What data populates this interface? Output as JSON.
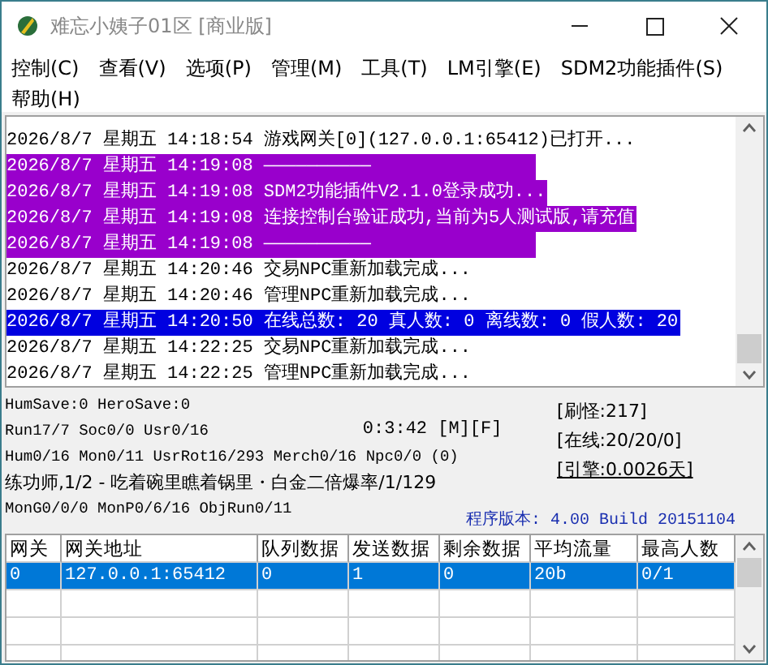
{
  "window": {
    "title": "难忘小姨子01区 [商业版]"
  },
  "menu": [
    {
      "label": "控制(C)"
    },
    {
      "label": "查看(V)"
    },
    {
      "label": "选项(P)"
    },
    {
      "label": "管理(M)"
    },
    {
      "label": "工具(T)"
    },
    {
      "label": "LM引擎(E)"
    },
    {
      "label": "SDM2功能插件(S)"
    },
    {
      "label": "帮助(H)"
    }
  ],
  "log": [
    {
      "date": "2026/8/7",
      "weekday": "星期五",
      "time": "14:18:54",
      "message": "游戏网关[0](127.0.0.1:65412)已打开..."
    },
    {
      "date": "2026/8/7",
      "weekday": "星期五",
      "time": "14:19:08",
      "message": "――――――――――",
      "color": "#9900cc"
    },
    {
      "date": "2026/8/7",
      "weekday": "星期五",
      "time": "14:19:08",
      "message": "SDM2功能插件V2.1.0登录成功...",
      "color": "#9900cc"
    },
    {
      "date": "2026/8/7",
      "weekday": "星期五",
      "time": "14:19:08",
      "message": "连接控制台验证成功,当前为5人测试版,请充值",
      "color": "#9900cc"
    },
    {
      "date": "2026/8/7",
      "weekday": "星期五",
      "time": "14:19:08",
      "message": "――――――――――",
      "color": "#9900cc"
    },
    {
      "date": "2026/8/7",
      "weekday": "星期五",
      "time": "14:20:46",
      "message": "交易NPC重新加载完成..."
    },
    {
      "date": "2026/8/7",
      "weekday": "星期五",
      "time": "14:20:46",
      "message": "管理NPC重新加载完成..."
    },
    {
      "date": "2026/8/7",
      "weekday": "星期五",
      "time": "14:20:50",
      "message": "在线总数: 20 真人数: 0 离线数: 0 假人数: 20",
      "color": "#0000e0"
    },
    {
      "date": "2026/8/7",
      "weekday": "星期五",
      "time": "14:22:25",
      "message": "交易NPC重新加载完成..."
    },
    {
      "date": "2026/8/7",
      "weekday": "星期五",
      "time": "14:22:25",
      "message": "管理NPC重新加载完成..."
    }
  ],
  "status": {
    "lines": [
      {
        "text": "HumSave:0 HeroSave:0",
        "kind": "mono"
      },
      {
        "text": "Run17/7 Soc0/0 Usr0/16",
        "kind": "mono",
        "timer": "0:3:42 [M][F]"
      },
      {
        "text": "Hum0/16 Mon0/11 UsrRot16/293 Merch0/16 Npc0/0 (0)",
        "kind": "mono"
      },
      {
        "text": "练功师,1/2 - 吃着碗里瞧着锅里・白金二倍爆率/1/129",
        "kind": "sans"
      },
      {
        "text": "MonG0/0/0 MonP0/6/16 ObjRun0/11",
        "kind": "mono"
      }
    ],
    "counters": [
      {
        "text": "[刷怪:217]",
        "underlined": false
      },
      {
        "text": "[在线:20/20/0]",
        "underlined": false
      },
      {
        "text": "[引擎:0.0026天]",
        "underlined": true
      }
    ],
    "version": "程序版本: 4.00 Build 20151104"
  },
  "gateways": {
    "columns": [
      "网关",
      "网关地址",
      "队列数据",
      "发送数据",
      "剩余数据",
      "平均流量",
      "最高人数"
    ],
    "rows": [
      {
        "cells": [
          "0",
          "127.0.0.1:65412",
          "0",
          "1",
          "0",
          "20b",
          "0/1"
        ],
        "selected": true
      }
    ]
  }
}
